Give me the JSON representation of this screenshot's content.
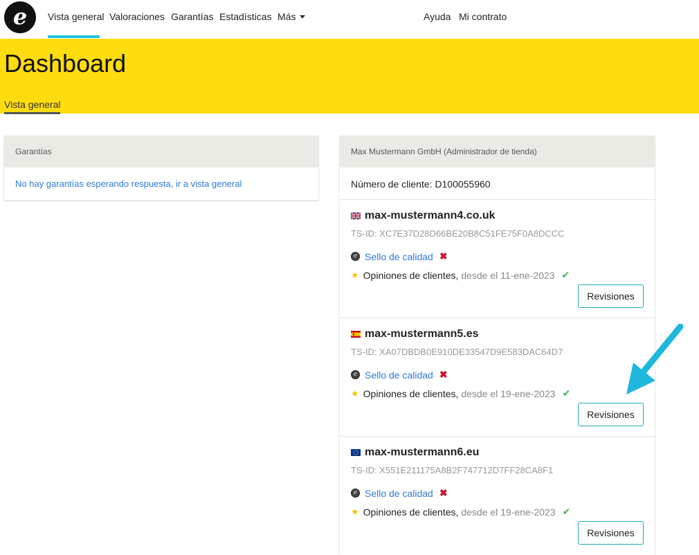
{
  "nav": {
    "logo_letter": "e",
    "items": [
      "Vista general",
      "Valoraciones",
      "Garantías",
      "Estadísticas",
      "Más"
    ],
    "right_items": [
      "Ayuda",
      "Mi contrato"
    ]
  },
  "header": {
    "title": "Dashboard",
    "subtab": "Vista general"
  },
  "guarantees_card": {
    "title": "Garantías",
    "link": "No hay garantías esperando respuesta, ir a vista general"
  },
  "shop_card": {
    "title": "Max Mustermann GmbH (Administrador de tienda)",
    "customer_number": "Número de cliente: D100055960",
    "shops": [
      {
        "domain": "max-mustermann4.co.uk",
        "flag": "uk-flag-icon",
        "tsid": "TS-ID: XC7E37D28D66BE20B8C51FE75F0A8DCCC",
        "seal_label": "Sello de calidad",
        "reviews_label": "Opiniones de clientes,",
        "reviews_since": "desde el 11-ene-2023",
        "button": "Revisiones"
      },
      {
        "domain": "max-mustermann5.es",
        "flag": "spain-flag-icon",
        "tsid": "TS-ID: XA07DBDB0E910DE33547D9E583DAC64D7",
        "seal_label": "Sello de calidad",
        "reviews_label": "Opiniones de clientes,",
        "reviews_since": "desde el 19-ene-2023",
        "button": "Revisiones"
      },
      {
        "domain": "max-mustermann6.eu",
        "flag": "eu-flag-icon",
        "tsid": "TS-ID: X551E211175A8B2F747712D7FF28CA8F1",
        "seal_label": "Sello de calidad",
        "reviews_label": "Opiniones de clientes,",
        "reviews_since": "desde el 19-ene-2023",
        "button": "Revisiones"
      }
    ]
  },
  "colors": {
    "brand_yellow": "#ffdc0f",
    "accent_cyan": "#20c4e0",
    "link_blue": "#2e7bd6",
    "cross_red": "#c8102e",
    "check_green": "#4caf50"
  }
}
